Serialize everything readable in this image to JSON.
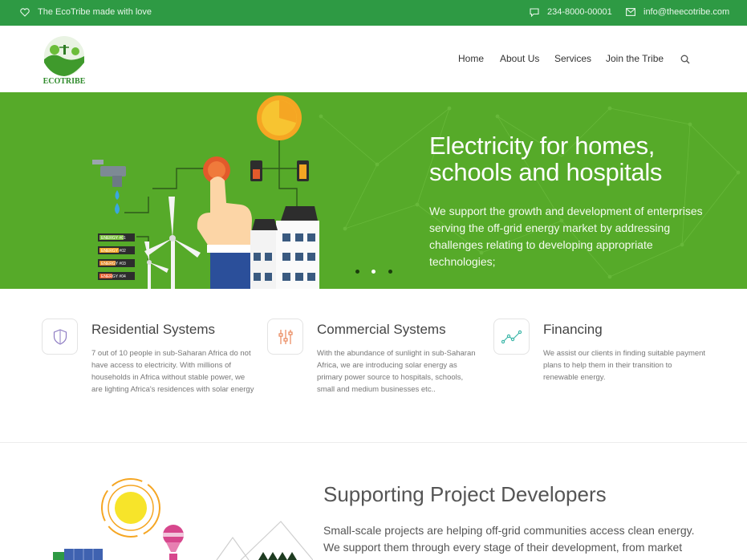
{
  "topbar": {
    "tagline": "The EcoTribe made with love",
    "phone": "234-8000-00001",
    "email": "info@theecotribe.com"
  },
  "header": {
    "logo_text": "ECOTRIBE",
    "nav": [
      "Home",
      "About Us",
      "Services",
      "Join the Tribe"
    ]
  },
  "hero": {
    "title": "Electricity for homes, schools and hospitals",
    "text": "We support the growth and development of enterprises serving the off-grid energy market by addressing challenges relating to developing appropriate technologies;",
    "battery_labels": [
      "ENERGY #01",
      "ENERGY #02",
      "ENERGY #03",
      "ENERGY #04"
    ],
    "slides": 3,
    "active_slide": 1
  },
  "features": [
    {
      "title": "Residential Systems",
      "text": "7 out of 10 people in sub-Saharan Africa do not have access to electricity. With millions of households in Africa without stable power, we are lighting Africa's residences with solar energy",
      "icon": "shield-icon"
    },
    {
      "title": "Commercial Systems",
      "text": "With the abundance of sunlight in sub-Saharan Africa, we are introducing solar energy as primary power source to hospitals, schools, small and medium businesses etc..",
      "icon": "sliders-icon"
    },
    {
      "title": "Financing",
      "text": "We assist our clients in finding suitable payment plans to help them in their transition to renewable energy.",
      "icon": "line-chart-icon"
    }
  ],
  "support": {
    "title": "Supporting Project Developers",
    "text": "Small-scale projects are helping off-grid communities access clean energy. We support them through every stage of their development, from market sizing to"
  },
  "colors": {
    "topbar": "#2e9a44",
    "hero": "#56aa29",
    "icon_purple": "#8e7cc3",
    "icon_orange": "#e8875b",
    "icon_teal": "#3bb6a8"
  }
}
